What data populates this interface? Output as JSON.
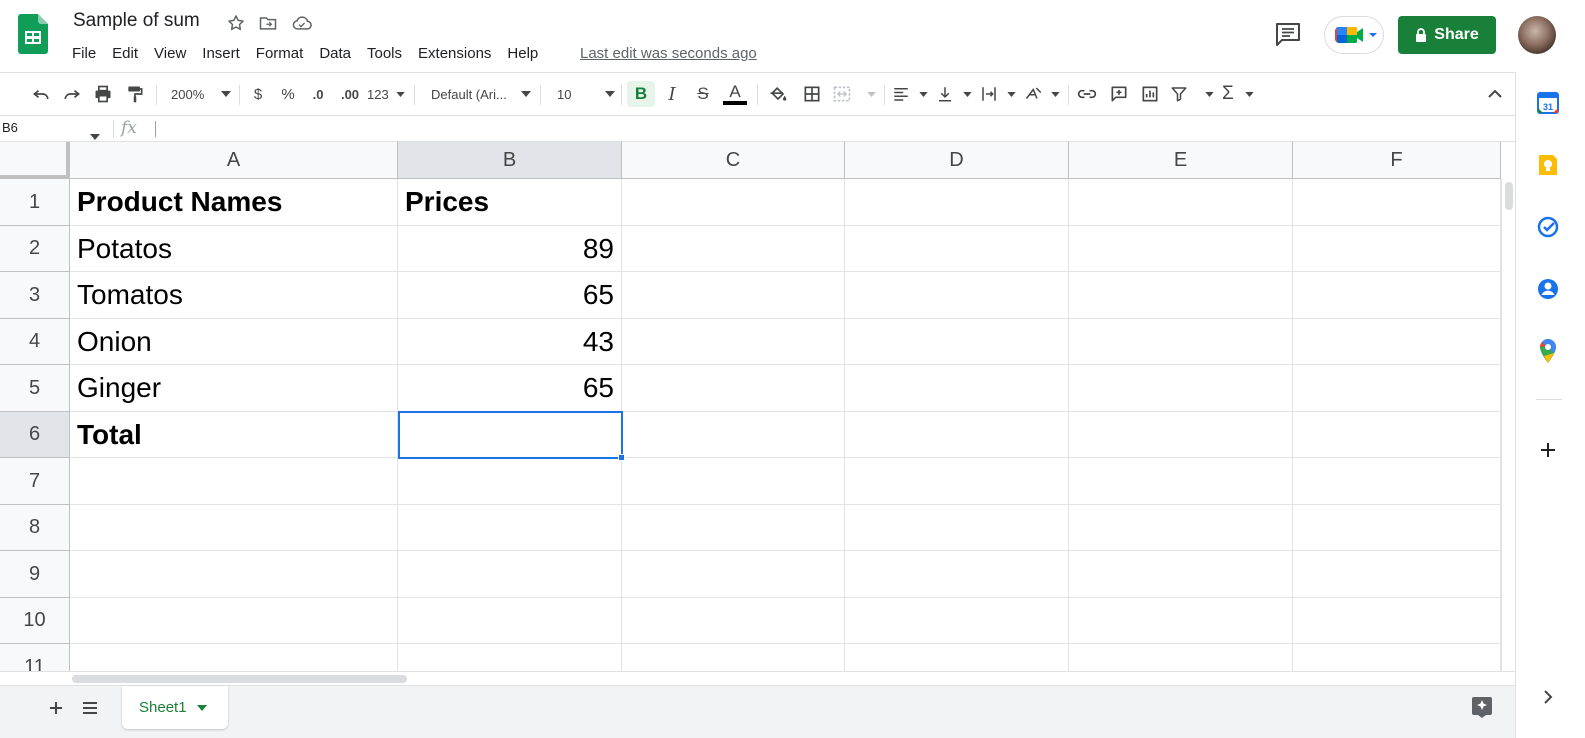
{
  "app": {
    "doc_title": "Sample of sum",
    "last_edit": "Last edit was seconds ago",
    "share_label": "Share"
  },
  "menu": [
    "File",
    "Edit",
    "View",
    "Insert",
    "Format",
    "Data",
    "Tools",
    "Extensions",
    "Help"
  ],
  "toolbar": {
    "zoom": "200%",
    "currency": "$",
    "percent": "%",
    "decrease_decimal": ".0",
    "increase_decimal": ".00",
    "number_format": "123",
    "font": "Default (Ari...",
    "font_size": "10",
    "bold": "B",
    "italic": "I",
    "strikethrough": "S",
    "text_color": "A",
    "functions": "Σ"
  },
  "formula_bar": {
    "name_box": "B6",
    "fx": "fx",
    "value": ""
  },
  "grid": {
    "columns": [
      "A",
      "B",
      "C",
      "D",
      "E",
      "F"
    ],
    "rows": [
      "1",
      "2",
      "3",
      "4",
      "5",
      "6",
      "7",
      "8",
      "9",
      "10",
      "11"
    ],
    "selected_cell": "B6",
    "cells": [
      [
        "Product Names",
        "Prices",
        "",
        "",
        "",
        ""
      ],
      [
        "Potatos",
        "89",
        "",
        "",
        "",
        ""
      ],
      [
        "Tomatos",
        "65",
        "",
        "",
        "",
        ""
      ],
      [
        "Onion",
        "43",
        "",
        "",
        "",
        ""
      ],
      [
        "Ginger",
        "65",
        "",
        "",
        "",
        ""
      ],
      [
        "Total",
        "",
        "",
        "",
        "",
        ""
      ],
      [
        "",
        "",
        "",
        "",
        "",
        ""
      ],
      [
        "",
        "",
        "",
        "",
        "",
        ""
      ],
      [
        "",
        "",
        "",
        "",
        "",
        ""
      ],
      [
        "",
        "",
        "",
        "",
        "",
        ""
      ],
      [
        "",
        "",
        "",
        "",
        "",
        ""
      ]
    ]
  },
  "sheets": {
    "tabs": [
      "Sheet1"
    ],
    "active": "Sheet1"
  },
  "side_panel": {
    "calendar_day": "31",
    "icons": [
      "calendar-icon",
      "keep-icon",
      "tasks-icon",
      "contacts-icon",
      "maps-icon",
      "add-icon"
    ]
  },
  "colors": {
    "brand_green": "#188038",
    "selection_blue": "#1a73e8",
    "header_bg": "#f8f9fa",
    "selected_header_bg": "#e1e5ea"
  }
}
